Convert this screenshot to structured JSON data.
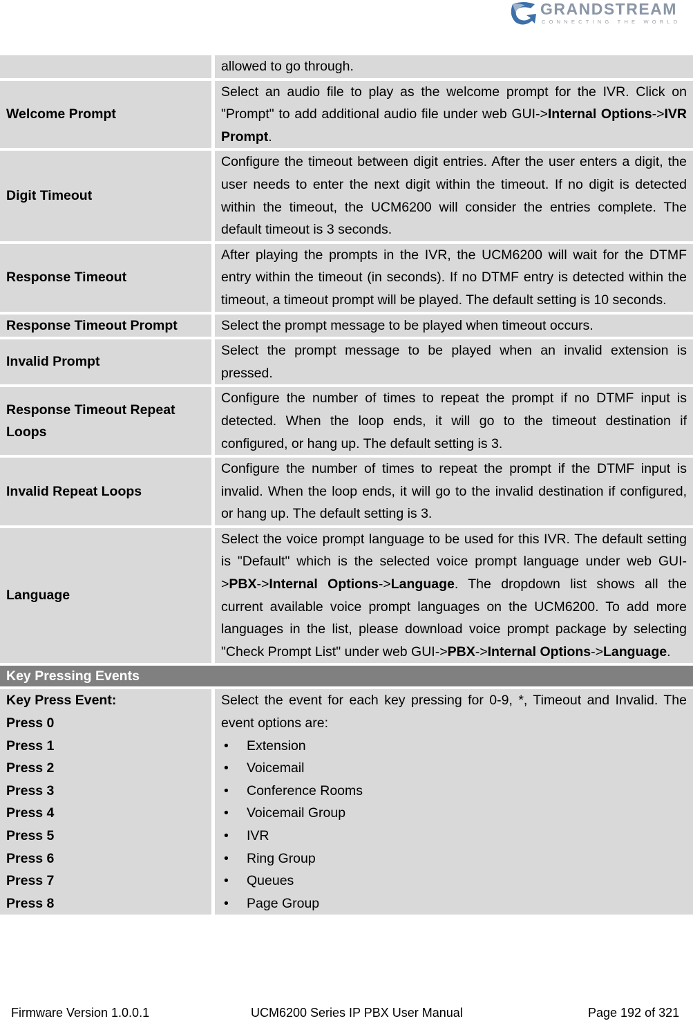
{
  "header": {
    "logo_word": "GRANDSTREAM",
    "logo_tagline": "CONNECTING THE WORLD",
    "logo_icon": "grandstream-swirl-icon"
  },
  "table": {
    "continued_row": {
      "key": "",
      "value": "allowed to go through."
    },
    "rows": [
      {
        "key": "Welcome Prompt",
        "parts": [
          "Select an audio file to play as the welcome prompt for the IVR. Click on \"Prompt\" to add additional audio file under web GUI->",
          {
            "b": "Internal Options"
          },
          "->",
          {
            "b": "IVR Prompt"
          },
          "."
        ]
      },
      {
        "key": "Digit Timeout",
        "parts": [
          "Configure the timeout between digit entries. After the user enters a digit, the user needs to enter the next digit within the timeout. If no digit is detected within the timeout, the UCM6200 will consider the entries complete. The default timeout is 3 seconds."
        ]
      },
      {
        "key": "Response Timeout",
        "parts": [
          "After playing the prompts in the IVR, the UCM6200 will wait for the DTMF entry within the timeout (in seconds). If no DTMF entry is detected within the timeout, a timeout prompt will be played. The default setting is 10 seconds."
        ]
      },
      {
        "key": "Response Timeout Prompt",
        "parts": [
          "Select the prompt message to be played when timeout occurs."
        ]
      },
      {
        "key": "Invalid Prompt",
        "parts": [
          "Select the prompt message to be played when an invalid extension is pressed."
        ]
      },
      {
        "key": "Response Timeout Repeat Loops",
        "parts": [
          "Configure the number of times to repeat the prompt if no DTMF input is detected. When the loop ends, it will go to the timeout destination if configured, or hang up. The default setting is 3."
        ]
      },
      {
        "key": "Invalid Repeat Loops",
        "parts": [
          "Configure the number of times to repeat the prompt if the DTMF input is invalid. When the loop ends, it will go to the invalid destination if configured, or hang up. The default setting is 3."
        ]
      },
      {
        "key": "Language",
        "parts": [
          "Select the voice prompt language to be used for this IVR. The default setting is \"Default\" which is the selected voice prompt language under web GUI->",
          {
            "b": "PBX"
          },
          "->",
          {
            "b": "Internal Options"
          },
          "->",
          {
            "b": "Language"
          },
          ". The dropdown list shows all the current available voice prompt languages on the UCM6200. To add more languages in the list, please download voice prompt package by selecting \"Check Prompt List\" under web GUI->",
          {
            "b": "PBX"
          },
          "->",
          {
            "b": "Internal Options"
          },
          "->",
          {
            "b": "Language"
          },
          "."
        ]
      }
    ],
    "section_header": "Key Pressing Events",
    "key_press": {
      "keys": [
        "Key Press Event:",
        "Press 0",
        "Press 1",
        "Press 2",
        "Press 3",
        "Press 4",
        "Press 5",
        "Press 6",
        "Press 7",
        "Press 8"
      ],
      "description": "Select the event for each key pressing for 0-9, *, Timeout and Invalid. The event options are:",
      "options": [
        "Extension",
        "Voicemail",
        "Conference Rooms",
        "Voicemail Group",
        "IVR",
        "Ring Group",
        "Queues",
        "Page Group"
      ]
    }
  },
  "footer": {
    "firmware": "Firmware Version 1.0.0.1",
    "manual": "UCM6200 Series IP PBX User Manual",
    "page": "Page 192 of 321"
  }
}
